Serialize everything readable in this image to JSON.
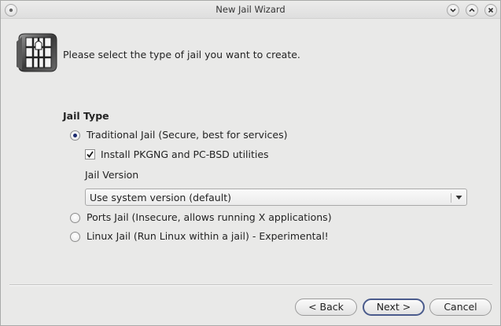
{
  "window": {
    "title": "New Jail Wizard"
  },
  "header": {
    "text": "Please select the type of jail you want to create."
  },
  "jail_type": {
    "group_title": "Jail Type",
    "traditional": {
      "label": "Traditional Jail (Secure, best for services)",
      "checked": true
    },
    "install_pkgng": {
      "label": "Install PKGNG and PC-BSD utilities",
      "checked": true
    },
    "version_label": "Jail Version",
    "version_selected": "Use system version (default)",
    "ports": {
      "label": "Ports Jail (Insecure, allows running X applications)",
      "checked": false
    },
    "linux": {
      "label": "Linux Jail (Run Linux within a jail) - Experimental!",
      "checked": false
    }
  },
  "buttons": {
    "back": "< Back",
    "next": "Next >",
    "cancel": "Cancel"
  },
  "colors": {
    "window_bg": "#e9e9e8",
    "default_button_border": "#4a5b8c",
    "radio_dot": "#1c2a6e"
  }
}
